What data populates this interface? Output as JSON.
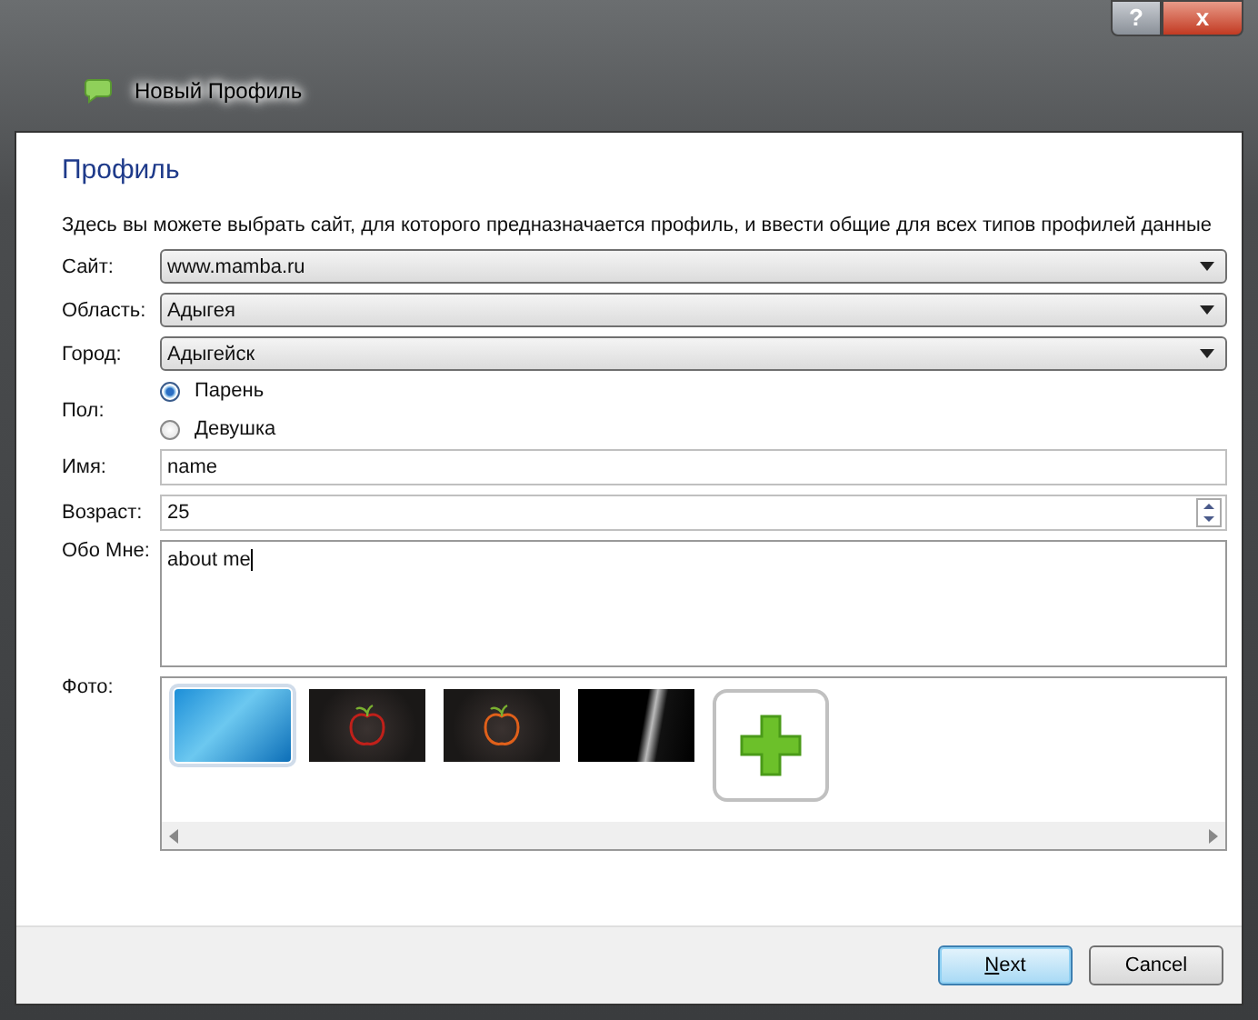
{
  "window": {
    "title": "Новый Профиль",
    "help_button": "?",
    "close_button": "x"
  },
  "heading": "Профиль",
  "description": "Здесь вы можете выбрать сайт, для которого предназначается профиль, и ввести общие для всех типов профилей данные",
  "fields": [
    {
      "kind": "dropdown",
      "label": "Сайт:",
      "value": "www.mamba.ru"
    },
    {
      "kind": "dropdown",
      "label": "Область:",
      "value": "Адыгея"
    },
    {
      "kind": "dropdown",
      "label": "Город:",
      "value": "Адыгейск"
    },
    {
      "kind": "radio",
      "label": "Пол:",
      "options": [
        {
          "label": "Парень",
          "selected": true
        },
        {
          "label": "Девушка",
          "selected": false
        }
      ]
    },
    {
      "kind": "text",
      "label": "Имя:",
      "value": "name"
    },
    {
      "kind": "spin",
      "label": "Возраст:",
      "value": "25"
    },
    {
      "kind": "textarea",
      "label": "Обо Мне:",
      "value": "about me"
    }
  ],
  "photos": {
    "label": "Фото:",
    "items": [
      {
        "kind": "sky",
        "selected": true
      },
      {
        "kind": "red-apple",
        "selected": false
      },
      {
        "kind": "orange-apple",
        "selected": false
      },
      {
        "kind": "dark",
        "selected": false
      }
    ]
  },
  "buttons": [
    {
      "label": "Next",
      "default": true
    },
    {
      "label": "Cancel",
      "default": false
    }
  ]
}
